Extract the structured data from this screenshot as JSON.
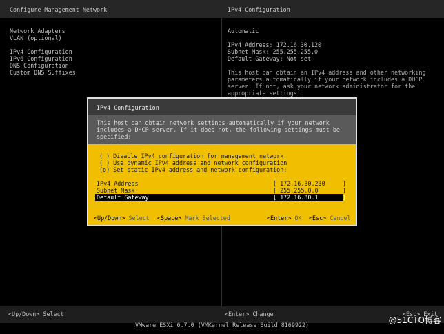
{
  "header": {
    "left_title": "Configure Management Network",
    "right_title": "IPv4 Configuration"
  },
  "menu": {
    "items": [
      "Network Adapters",
      "VLAN (optional)",
      "IPv4 Configuration",
      "IPv6 Configuration",
      "DNS Configuration",
      "Custom DNS Suffixes"
    ]
  },
  "info": {
    "mode": "Automatic",
    "ipv4_address": "IPv4 Address: 172.16.30.120",
    "subnet_mask": "Subnet Mask: 255.255.255.0",
    "default_gateway": "Default Gateway: Not set",
    "description": "This host can obtain an IPv4 address and other networking parameters automatically if your network includes a DHCP server. If not, ask your network administrator for the appropriate settings."
  },
  "dialog": {
    "title": "IPv4 Configuration",
    "description": "This host can obtain network settings automatically if your network includes a DHCP server. If it does not, the following settings must be specified:",
    "options": [
      "( ) Disable IPv4 configuration for management network",
      "( ) Use dynamic IPv4 address and network configuration",
      "(o) Set static IPv4 address and network configuration:"
    ],
    "fields": {
      "ip_label": "IPv4 Address",
      "ip_value": "[ 172.16.30.230     ]",
      "mask_label": "Subnet Mask",
      "mask_value": "[ 255.255.0.0       ]",
      "gw_label": "Default Gateway",
      "gw_value": "[ 172.16.30.1       ]"
    },
    "keys": {
      "updown_key": "<Up/Down>",
      "updown_action": "Select",
      "space_key": "<Space>",
      "space_action": "Mark Selected",
      "enter_key": "<Enter>",
      "enter_action": "OK",
      "esc_key": "<Esc>",
      "esc_action": "Cancel"
    }
  },
  "bottom": {
    "left": "<Up/Down> Select",
    "center": "<Enter> Change",
    "right": "<Esc> Exit"
  },
  "footer": "VMware ESXi 6.7.0 (VMKernel Release Build 8169922)",
  "watermark": "@51CTO博客"
}
